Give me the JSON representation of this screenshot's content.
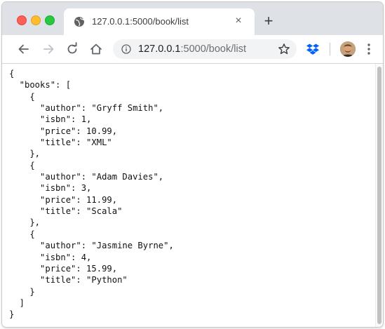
{
  "tab": {
    "title": "127.0.0.1:5000/book/list",
    "close_glyph": "×",
    "favicon": "globe-icon"
  },
  "new_tab_glyph": "+",
  "toolbar": {
    "icons": [
      "back-arrow-icon",
      "forward-arrow-icon",
      "reload-icon",
      "home-icon",
      "info-icon",
      "star-icon",
      "dropbox-icon",
      "avatar",
      "kebab-menu-icon"
    ]
  },
  "address": {
    "host": "127.0.0.1",
    "path": ":5000/book/list"
  },
  "json_lines": [
    "{",
    "  \"books\": [",
    "    {",
    "      \"author\": \"Gryff Smith\",",
    "      \"isbn\": 1,",
    "      \"price\": 10.99,",
    "      \"title\": \"XML\"",
    "    },",
    "    {",
    "      \"author\": \"Adam Davies\",",
    "      \"isbn\": 3,",
    "      \"price\": 11.99,",
    "      \"title\": \"Scala\"",
    "    },",
    "    {",
    "      \"author\": \"Jasmine Byrne\",",
    "      \"isbn\": 4,",
    "      \"price\": 15.99,",
    "      \"title\": \"Python\"",
    "    }",
    "  ]",
    "}"
  ],
  "colors": {
    "traffic_red": "#fe5f57",
    "traffic_yellow": "#febc2e",
    "traffic_green": "#28c840",
    "tabstrip": "#dee1e6",
    "omnibox": "#f1f3f4",
    "dropbox_blue": "#0061fe"
  }
}
